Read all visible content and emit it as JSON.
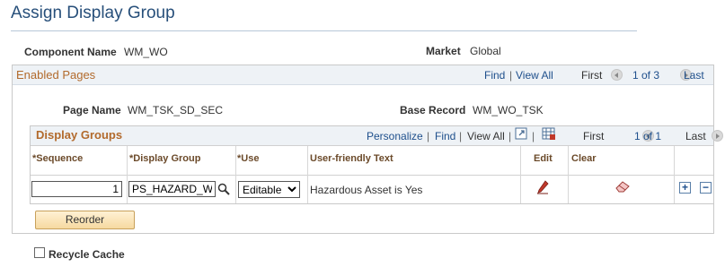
{
  "page": {
    "title": "Assign Display Group"
  },
  "fields": {
    "component_label": "Component Name",
    "component_value": "WM_WO",
    "market_label": "Market",
    "market_value": "Global"
  },
  "enabled_pages": {
    "title": "Enabled Pages",
    "find": "Find",
    "view_all": "View All",
    "first": "First",
    "range": "1 of 3",
    "last": "Last",
    "page_name_label": "Page Name",
    "page_name_value": "WM_TSK_SD_SEC",
    "base_record_label": "Base Record",
    "base_record_value": "WM_WO_TSK"
  },
  "display_groups": {
    "title": "Display Groups",
    "personalize": "Personalize",
    "find": "Find",
    "view_all": "View All",
    "first": "First",
    "range": "1 of 1",
    "last": "Last",
    "columns": {
      "sequence": "*Sequence",
      "display_group": "*Display Group",
      "use": "*Use",
      "friendly": "User-friendly Text",
      "edit": "Edit",
      "clear": "Clear"
    },
    "row": {
      "sequence": "1",
      "display_group": "PS_HAZARD_WA",
      "use": "Editable",
      "use_options": [
        "Editable"
      ],
      "friendly": "Hazardous Asset is Yes"
    },
    "reorder": "Reorder"
  },
  "recycle_cache": {
    "label": "Recycle Cache",
    "checked": false
  },
  "icons": [
    "lookup-icon",
    "pencil-icon",
    "eraser-icon",
    "add-row-icon",
    "delete-row-icon",
    "zoom-icon",
    "download-grid-icon",
    "prev-icon",
    "next-icon"
  ]
}
